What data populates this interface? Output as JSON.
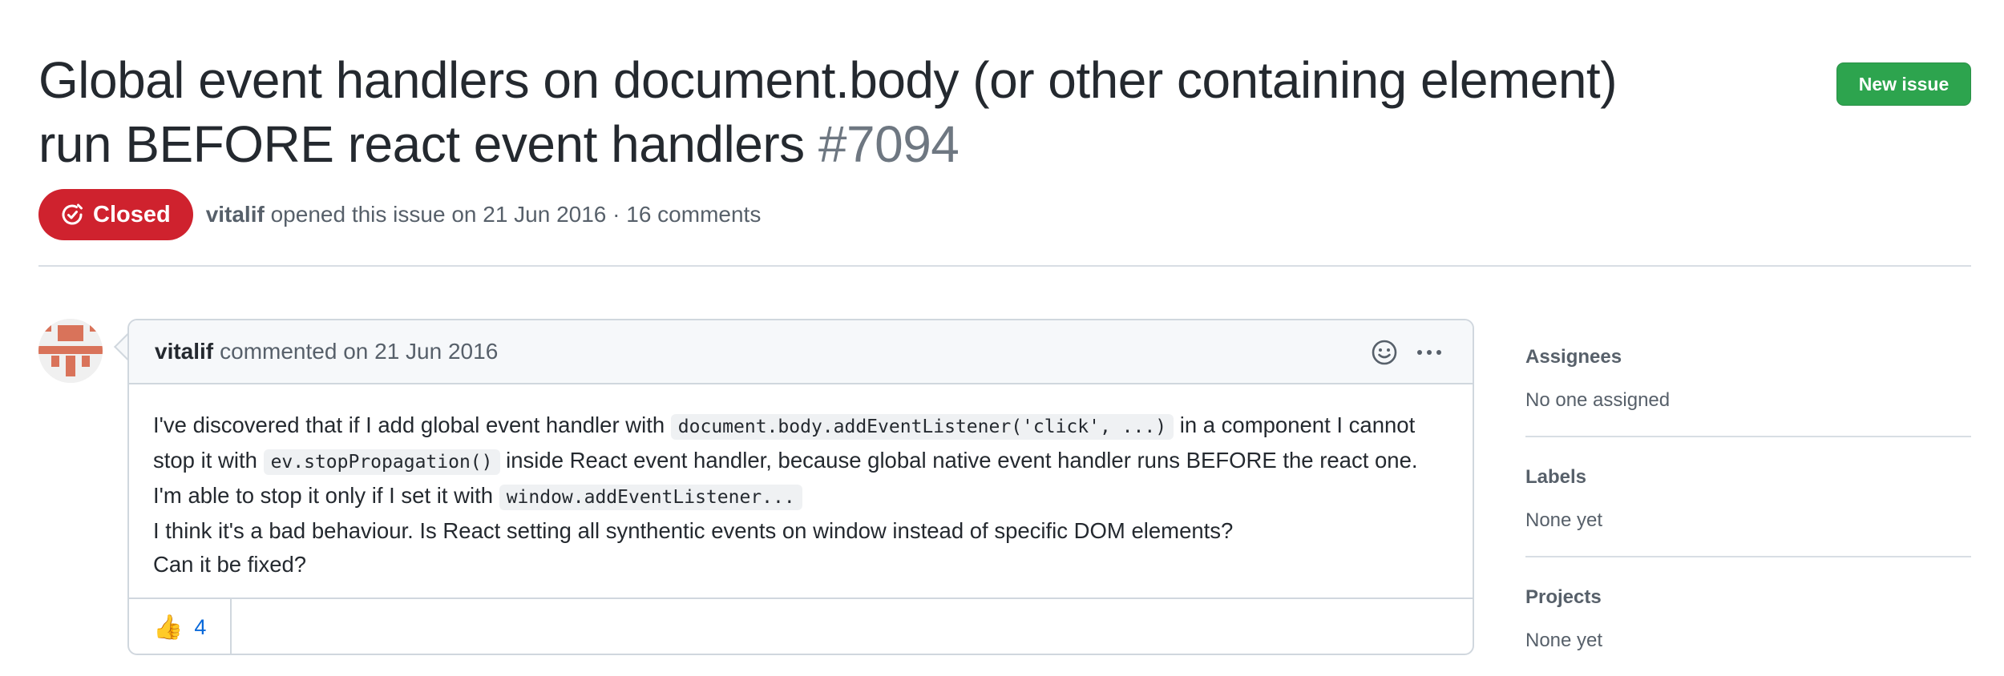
{
  "issue": {
    "title": "Global event handlers on document.body (or other containing element) run BEFORE react event handlers",
    "number": "#7094",
    "state": "Closed",
    "author": "vitalif",
    "opened_text": "opened this issue on 21 Jun 2016 · 16 comments"
  },
  "header": {
    "new_issue_label": "New issue"
  },
  "comment": {
    "author": "vitalif",
    "action_text": "commented on 21 Jun 2016",
    "body": {
      "p1_a": "I've discovered that if I add global event handler with ",
      "p1_code1": "document.body.addEventListener('click', ...)",
      "p1_b": " in a component I cannot stop it with ",
      "p1_code2": "ev.stopPropagation()",
      "p1_c": " inside React event handler, because global native event handler runs BEFORE the react one. I'm able to stop it only if I set it with ",
      "p1_code3": "window.addEventListener...",
      "p2": "I think it's a bad behaviour. Is React setting all synthentic events on window instead of specific DOM elements?",
      "p3": "Can it be fixed?"
    },
    "reactions": [
      {
        "icon": "thumbs-up-emoji",
        "emoji": "👍",
        "count": "4"
      }
    ]
  },
  "sidebar": {
    "sections": [
      {
        "heading": "Assignees",
        "value": "No one assigned"
      },
      {
        "heading": "Labels",
        "value": "None yet"
      },
      {
        "heading": "Projects",
        "value": "None yet"
      }
    ]
  },
  "colors": {
    "closed_badge": "#cf222e",
    "new_issue_button": "#2da44e",
    "link": "#0969da",
    "header_bg": "#f6f8fa",
    "border": "#d0d7de"
  },
  "icons": [
    "issue-closed-icon",
    "identicon-avatar",
    "smiley-icon",
    "kebab-menu-icon"
  ]
}
